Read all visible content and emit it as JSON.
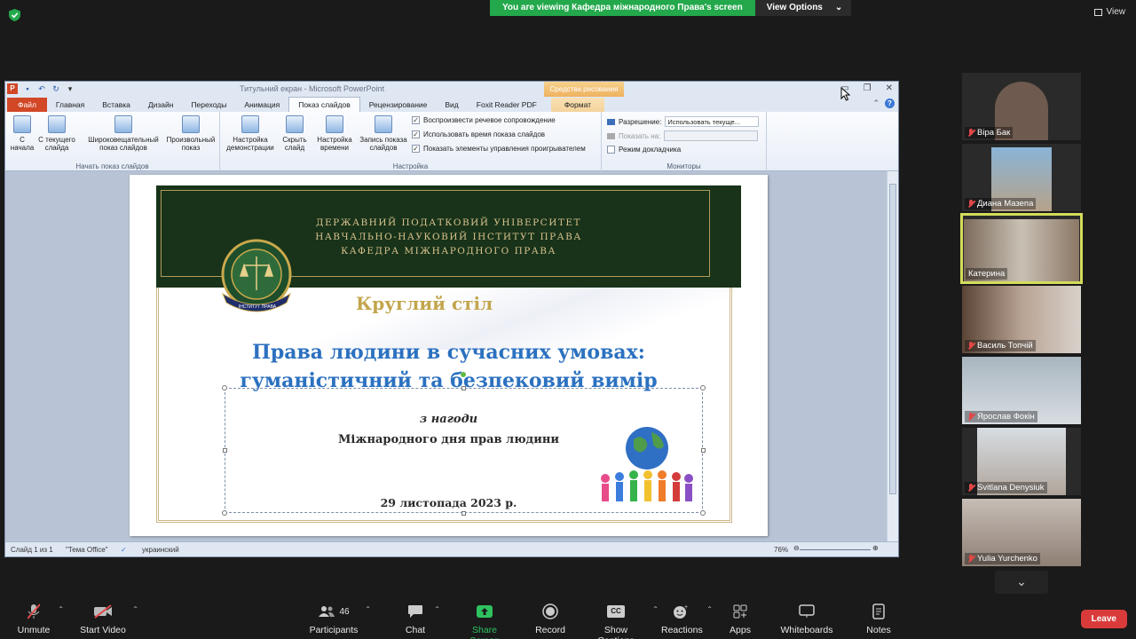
{
  "banner": {
    "message": "You are viewing Кафедра міжнародного Права's screen",
    "options": "View Options"
  },
  "view_button": "View",
  "ppt": {
    "window_title": "Титульний екран  -  Microsoft PowerPoint",
    "context_tools": "Средства рисования",
    "tabs": [
      "Файл",
      "Главная",
      "Вставка",
      "Дизайн",
      "Переходы",
      "Анимация",
      "Показ слайдов",
      "Рецензирование",
      "Вид",
      "Foxit Reader PDF",
      "Формат"
    ],
    "ribbon": {
      "btn_start": "С начала",
      "btn_current": "С текущего слайда",
      "btn_broadcast": "Широковещательный показ слайдов",
      "btn_custom": "Произвольный показ",
      "group_start": "Начать показ слайдов",
      "btn_setup": "Настройка демонстрации",
      "btn_hide": "Скрыть слайд",
      "btn_timing": "Настройка времени",
      "btn_record": "Запись показа слайдов",
      "chk_narration": "Воспроизвести речевое сопровождение",
      "chk_timings": "Использовать время показа слайдов",
      "chk_controls": "Показать элементы управления проигрывателем",
      "group_setup": "Настройка",
      "resolution_label": "Разрешение:",
      "resolution_value": "Использовать текуще...",
      "show_on_label": "Показать на:",
      "presenter_label": "Режим докладчика",
      "group_monitors": "Мониторы"
    },
    "slide": {
      "univ_line1": "ДЕРЖАВНИЙ ПОДАТКОВИЙ УНІВЕРСИТЕТ",
      "univ_line2": "НАВЧАЛЬНО-НАУКОВИЙ ІНСТИТУТ ПРАВА",
      "univ_line3": "КАФЕДРА МІЖНАРОДНОГО ПРАВА",
      "seal_text": "ІНСТИТУТ ПРАВА",
      "round_table": "Круглий стіл",
      "title_line1": "Права людини в сучасних умовах:",
      "title_line2": "гуманістичний та безпековий вимір",
      "occasion": "з нагоди",
      "day": "Міжнародного дня прав людини",
      "date": "29 листопада 2023 р."
    },
    "status": {
      "slide": "Слайд 1 из 1",
      "theme": "\"Тема Office\"",
      "lang": "украинский",
      "zoom": "76%"
    }
  },
  "participants": [
    {
      "name": "Віра Бак",
      "muted": true
    },
    {
      "name": "Диана Мазепа",
      "muted": true
    },
    {
      "name": "Катерина",
      "muted": false
    },
    {
      "name": "Василь Топчій",
      "muted": true
    },
    {
      "name": "Ярослав Фокін",
      "muted": true
    },
    {
      "name": "Svitlana Denysiuk",
      "muted": true
    },
    {
      "name": "Yulia Yurchenko",
      "muted": true
    }
  ],
  "toolbar": {
    "unmute": "Unmute",
    "start_video": "Start Video",
    "participants": "Participants",
    "participants_count": "46",
    "chat": "Chat",
    "share_screen": "Share Screen",
    "record": "Record",
    "show_captions": "Show Captions",
    "reactions": "Reactions",
    "apps": "Apps",
    "whiteboards": "Whiteboards",
    "notes": "Notes",
    "leave": "Leave"
  },
  "colors": {
    "share_green": "#23a84b",
    "leave_red": "#d93b3b",
    "active_speaker": "#d3dc59",
    "slide_title_blue": "#2c71c0",
    "slide_gold": "#c2a54c",
    "slide_green": "#183319"
  }
}
